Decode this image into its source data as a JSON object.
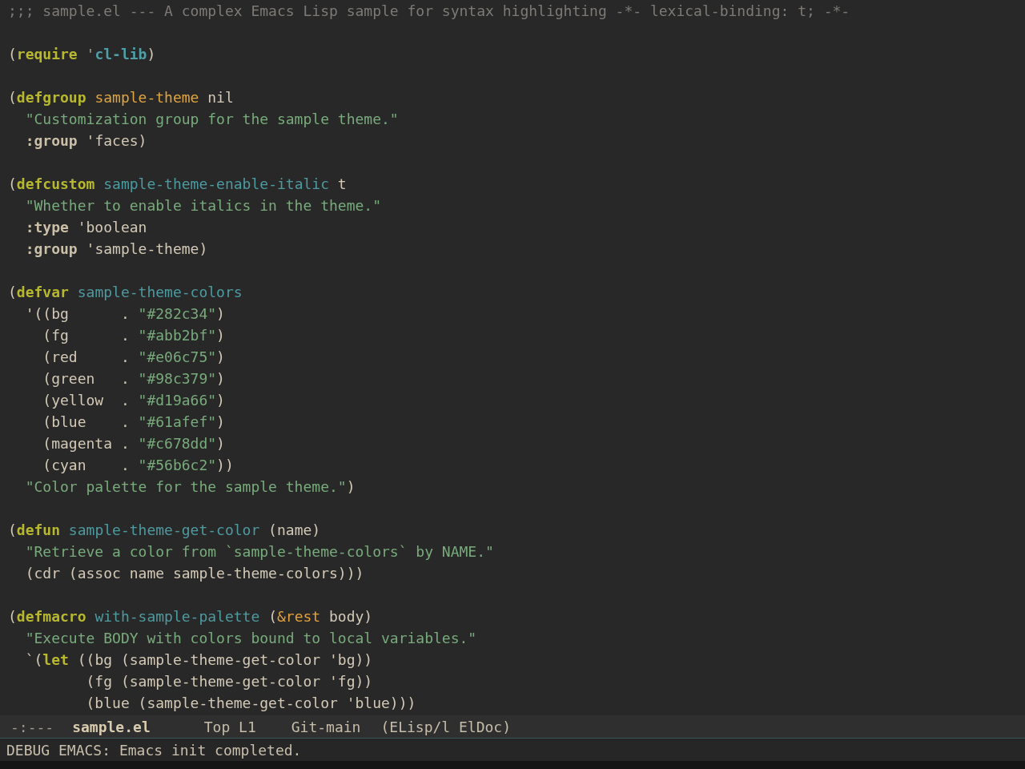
{
  "buffer": {
    "blocks": [
      {
        "lines": [
          {
            "tokens": [
              {
                "kind": "comment",
                "text": ";;; sample.el --- A complex Emacs Lisp sample for syntax highlighting -*- lexical-binding: t; -*-"
              }
            ]
          }
        ]
      },
      {
        "lines": [
          {
            "tokens": [
              {
                "kind": "plain",
                "text": "("
              },
              {
                "kind": "keyword",
                "text": "require"
              },
              {
                "kind": "quote",
                "text": " '"
              },
              {
                "kind": "constant",
                "text": "cl-lib"
              },
              {
                "kind": "plain",
                "text": ")"
              }
            ]
          }
        ]
      },
      {
        "lines": [
          {
            "tokens": [
              {
                "kind": "plain",
                "text": "("
              },
              {
                "kind": "keyword",
                "text": "defgroup"
              },
              {
                "kind": "type",
                "text": " sample-theme"
              },
              {
                "kind": "plain",
                "text": " nil"
              }
            ]
          },
          {
            "tokens": [
              {
                "kind": "string",
                "text": "  \"Customization group for the sample theme.\""
              }
            ]
          },
          {
            "tokens": [
              {
                "kind": "builtin",
                "text": "  :group"
              },
              {
                "kind": "plain",
                "text": " 'faces)"
              }
            ]
          }
        ]
      },
      {
        "lines": [
          {
            "tokens": [
              {
                "kind": "plain",
                "text": "("
              },
              {
                "kind": "keyword",
                "text": "defcustom"
              },
              {
                "kind": "name",
                "text": " sample-theme-enable-italic"
              },
              {
                "kind": "plain",
                "text": " t"
              }
            ]
          },
          {
            "tokens": [
              {
                "kind": "string",
                "text": "  \"Whether to enable italics in the theme.\""
              }
            ]
          },
          {
            "tokens": [
              {
                "kind": "builtin",
                "text": "  :type"
              },
              {
                "kind": "plain",
                "text": " 'boolean"
              }
            ]
          },
          {
            "tokens": [
              {
                "kind": "builtin",
                "text": "  :group"
              },
              {
                "kind": "plain",
                "text": " 'sample-theme)"
              }
            ]
          }
        ]
      },
      {
        "lines": [
          {
            "tokens": [
              {
                "kind": "plain",
                "text": "("
              },
              {
                "kind": "keyword",
                "text": "defvar"
              },
              {
                "kind": "name",
                "text": " sample-theme-colors"
              }
            ]
          },
          {
            "tokens": [
              {
                "kind": "plain",
                "text": "  '((bg      . "
              },
              {
                "kind": "string",
                "text": "\"#282c34\""
              },
              {
                "kind": "plain",
                "text": ")"
              }
            ]
          },
          {
            "tokens": [
              {
                "kind": "plain",
                "text": "    (fg      . "
              },
              {
                "kind": "string",
                "text": "\"#abb2bf\""
              },
              {
                "kind": "plain",
                "text": ")"
              }
            ]
          },
          {
            "tokens": [
              {
                "kind": "plain",
                "text": "    (red     . "
              },
              {
                "kind": "string",
                "text": "\"#e06c75\""
              },
              {
                "kind": "plain",
                "text": ")"
              }
            ]
          },
          {
            "tokens": [
              {
                "kind": "plain",
                "text": "    (green   . "
              },
              {
                "kind": "string",
                "text": "\"#98c379\""
              },
              {
                "kind": "plain",
                "text": ")"
              }
            ]
          },
          {
            "tokens": [
              {
                "kind": "plain",
                "text": "    (yellow  . "
              },
              {
                "kind": "string",
                "text": "\"#d19a66\""
              },
              {
                "kind": "plain",
                "text": ")"
              }
            ]
          },
          {
            "tokens": [
              {
                "kind": "plain",
                "text": "    (blue    . "
              },
              {
                "kind": "string",
                "text": "\"#61afef\""
              },
              {
                "kind": "plain",
                "text": ")"
              }
            ]
          },
          {
            "tokens": [
              {
                "kind": "plain",
                "text": "    (magenta . "
              },
              {
                "kind": "string",
                "text": "\"#c678dd\""
              },
              {
                "kind": "plain",
                "text": ")"
              }
            ]
          },
          {
            "tokens": [
              {
                "kind": "plain",
                "text": "    (cyan    . "
              },
              {
                "kind": "string",
                "text": "\"#56b6c2\""
              },
              {
                "kind": "plain",
                "text": "))"
              }
            ]
          },
          {
            "tokens": [
              {
                "kind": "string",
                "text": "  \"Color palette for the sample theme.\""
              },
              {
                "kind": "plain",
                "text": ")"
              }
            ]
          }
        ]
      },
      {
        "lines": [
          {
            "tokens": [
              {
                "kind": "plain",
                "text": "("
              },
              {
                "kind": "keyword",
                "text": "defun"
              },
              {
                "kind": "name",
                "text": " sample-theme-get-color"
              },
              {
                "kind": "plain",
                "text": " (name)"
              }
            ]
          },
          {
            "tokens": [
              {
                "kind": "string",
                "text": "  \"Retrieve a color from `sample-theme-colors` by NAME.\""
              }
            ]
          },
          {
            "tokens": [
              {
                "kind": "plain",
                "text": "  (cdr (assoc name sample-theme-colors)))"
              }
            ]
          }
        ]
      },
      {
        "lines": [
          {
            "tokens": [
              {
                "kind": "plain",
                "text": "("
              },
              {
                "kind": "keyword",
                "text": "defmacro"
              },
              {
                "kind": "name",
                "text": " with-sample-palette"
              },
              {
                "kind": "plain",
                "text": " ("
              },
              {
                "kind": "lambda",
                "text": "&rest"
              },
              {
                "kind": "plain",
                "text": " body)"
              }
            ]
          },
          {
            "tokens": [
              {
                "kind": "string",
                "text": "  \"Execute BODY with colors bound to local variables.\""
              }
            ]
          },
          {
            "tokens": [
              {
                "kind": "plain",
                "text": "  `("
              },
              {
                "kind": "keyword",
                "text": "let"
              },
              {
                "kind": "plain",
                "text": " ((bg (sample-theme-get-color 'bg))"
              }
            ]
          },
          {
            "tokens": [
              {
                "kind": "plain",
                "text": "         (fg (sample-theme-get-color 'fg))"
              }
            ]
          },
          {
            "tokens": [
              {
                "kind": "plain",
                "text": "         (blue (sample-theme-get-color 'blue)))"
              }
            ]
          }
        ]
      }
    ]
  },
  "mode_line": {
    "status": "-:---",
    "buffer_name": "sample.el",
    "position": "Top L1",
    "branch": "Git-main",
    "modes": "(ELisp/l ElDoc)"
  },
  "echo_area": {
    "message": "DEBUG EMACS: Emacs init completed."
  }
}
